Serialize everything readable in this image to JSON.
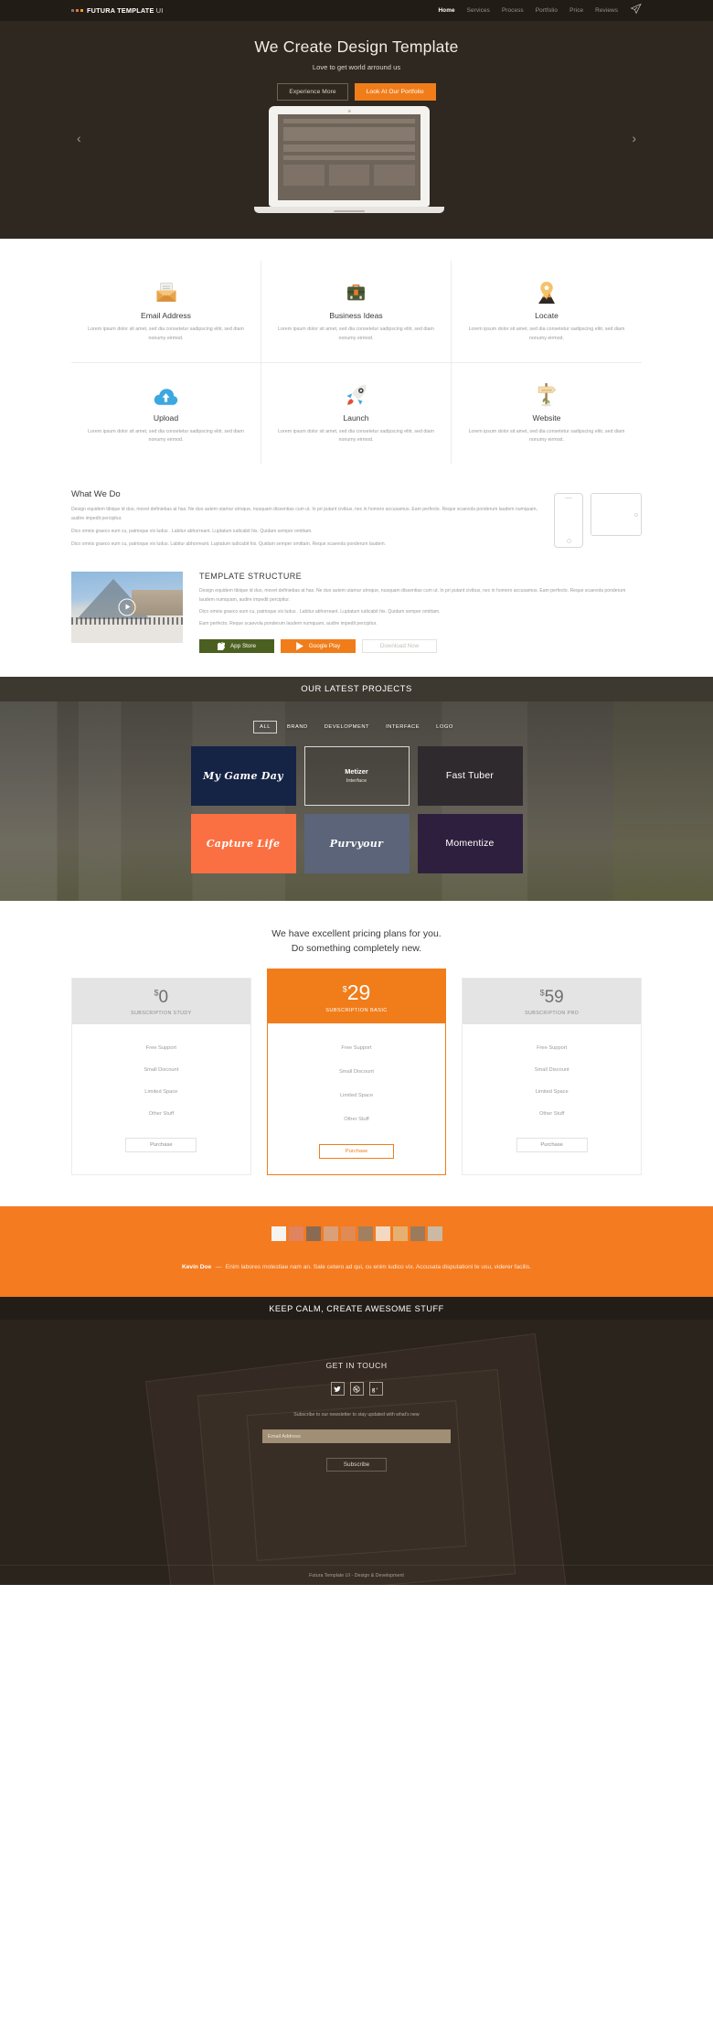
{
  "header": {
    "logo_main": "FUTURA TEMPLATE",
    "logo_light": "UI",
    "nav": [
      {
        "label": "Home",
        "active": true
      },
      {
        "label": "Services",
        "active": false
      },
      {
        "label": "Process",
        "active": false
      },
      {
        "label": "Portfolio",
        "active": false
      },
      {
        "label": "Price",
        "active": false
      },
      {
        "label": "Reviews",
        "active": false
      }
    ]
  },
  "hero": {
    "title": "We Create Design Template",
    "subtitle": "Love to get world arround us",
    "btn_secondary": "Experience More",
    "btn_primary": "Look At Our Portfolio",
    "arrow_prev": "‹",
    "arrow_next": "›"
  },
  "services": {
    "body": "Lorem ipsum dolor sit amet,  sed dia  consetetur sadipscing elitr, sed diam nonumy eirmod.",
    "items": [
      {
        "title": "Email Address",
        "icon": "envelope-letter-icon"
      },
      {
        "title": "Business Ideas",
        "icon": "briefcase-icon"
      },
      {
        "title": "Locate",
        "icon": "map-pin-icon"
      },
      {
        "title": "Upload",
        "icon": "cloud-upload-icon"
      },
      {
        "title": "Launch",
        "icon": "rocket-icon"
      },
      {
        "title": "Website",
        "icon": "signpost-www-icon"
      }
    ]
  },
  "whatwedo": {
    "title": "What We Do",
    "p1": "Design equidem tibique id duo, movet definiebas at has. Ne duo autem utamur utroque, nusquam dissentias cum ut. In pri putant civibus, nec in homero accusamus. Eam perfecto. Reque scaevola ponderum laudem numquam, audire impedit percipitur.",
    "p2": "Dico omnis graeco eum cu, patrioque vix ludus . Labitur abhorreant. Luptatum iudicabit his. Quidam semper omittam.",
    "p3": "Dico omnis graeco eum cu, patrioque vix ludus. Labitur abhorreant. Luptatum iudicabit his. Quidam semper omittam. Reque scaevola ponderum laudem."
  },
  "template_structure": {
    "title": "TEMPLATE STRUCTURE",
    "p1": "Design equidem tibique id duo, movet definiebas at has. Ne duo autem utamur utroque, nusquam dissentias cum ut. In pri putant civibus, nec in homero accusamus. Eam perfecto. Reque scaevola ponderum laudem numquam, audire impedit percipitur.",
    "p2": "Dico omnis graeco eum cu, patrioque vix ludus . Labitur abhorreant. Luptatum iudicabit his. Quidam semper omittam.",
    "p3": "Eam perfecto. Reque scaevola ponderum laudem numquam, audire impedit percipitur.",
    "btn_appstore": "App Store",
    "btn_googleplay": "Google Play",
    "btn_download": "Download Now"
  },
  "portfolio": {
    "heading": "OUR LATEST PROJECTS",
    "filters": [
      {
        "label": "ALL",
        "active": true
      },
      {
        "label": "BRAND",
        "active": false
      },
      {
        "label": "DEVELOPMENT",
        "active": false
      },
      {
        "label": "INTERFACE",
        "active": false
      },
      {
        "label": "LOGO",
        "active": false
      }
    ],
    "tiles": [
      {
        "name": "My Game Day",
        "sub": "",
        "bg": "#152345",
        "style": "script"
      },
      {
        "name": "Metizer",
        "sub": "Interface",
        "bg": "transparent",
        "style": "hover"
      },
      {
        "name": "Fast Tuber",
        "sub": "",
        "bg": "#2f2a2e",
        "style": "plain"
      },
      {
        "name": "Capture Life",
        "sub": "",
        "bg": "#fb7042",
        "style": "script"
      },
      {
        "name": "Purvyour",
        "sub": "",
        "bg": "#5b6479",
        "style": "script"
      },
      {
        "name": "Momentize",
        "sub": "",
        "bg": "#2f1f3e",
        "style": "plain"
      }
    ]
  },
  "pricing": {
    "heading_line1": "We have excellent pricing plans for you.",
    "heading_line2": "Do something completely new.",
    "features": [
      "Free Support",
      "Small Discount",
      "Limited Space",
      "Other Stuff"
    ],
    "purchase_label": "Purchase",
    "plans": [
      {
        "currency": "$",
        "amount": "0",
        "name": "SUBSCRIPTION STUDY",
        "featured": false
      },
      {
        "currency": "$",
        "amount": "29",
        "name": "SUBSCRIPTION BASIC",
        "featured": true
      },
      {
        "currency": "$",
        "amount": "59",
        "name": "SUBSCRIPTION PRO",
        "featured": false
      }
    ]
  },
  "testimonial": {
    "author": "Kevin Doe",
    "dash": "—",
    "quote": "Enim labores molestiae nam an. Sale cetero ad qui, cu enim iudico vix. Accusata disputationi te usu, viderer facilis.",
    "avatar_count": 10
  },
  "keepcalm": {
    "text": "KEEP CALM, CREATE AWESOME STUFF"
  },
  "footer": {
    "title": "GET IN TOUCH",
    "socials": [
      "twitter-icon",
      "dribbble-icon",
      "google-plus-icon"
    ],
    "newsletter_note": "Subscribe to our newsletter to stay updated with what's new",
    "email_placeholder": "Email Address",
    "email_value": "",
    "subscribe_label": "Subscribe",
    "copyright": "Futura Template UI - Design & Development"
  },
  "colors": {
    "accent_orange": "#f07d1a",
    "dark_brown": "#2e2820",
    "header_brown": "#211c16",
    "testimonial_orange": "#f47b20"
  }
}
